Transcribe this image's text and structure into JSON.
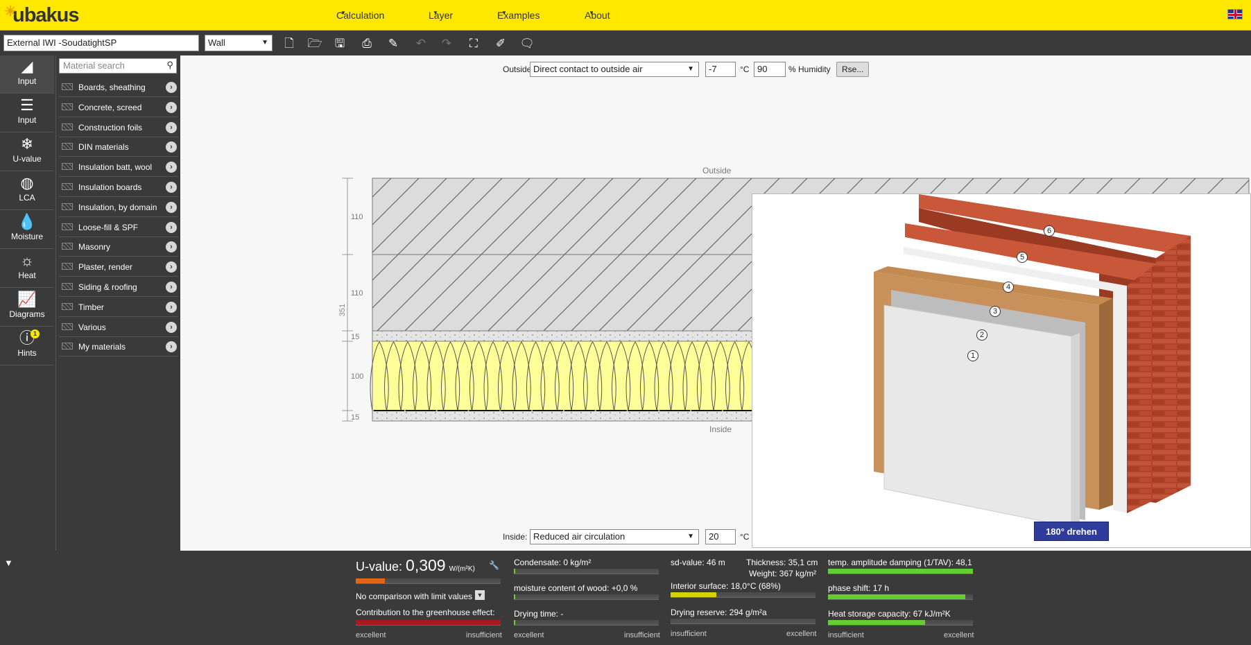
{
  "header": {
    "logo": "ubakus",
    "nav": [
      {
        "label": "Calculation"
      },
      {
        "label": "Layer"
      },
      {
        "label": "Examples"
      },
      {
        "label": "About"
      }
    ],
    "language_flag": "uk-flag-icon"
  },
  "toolbar": {
    "project_name": "External IWI -SoudatightSP",
    "construction_type": "Wall",
    "icons": [
      "new-file-icon",
      "open-folder-icon",
      "save-icon",
      "pdf-icon",
      "edit-icon",
      "undo-icon",
      "redo-icon",
      "fit-screen-icon",
      "brush-icon",
      "comment-icon"
    ]
  },
  "sidebar": {
    "items": [
      {
        "label": "Input",
        "icon": "slope-icon"
      },
      {
        "label": "Input",
        "icon": "layers-icon"
      },
      {
        "label": "U-value",
        "icon": "thermometer-icon"
      },
      {
        "label": "LCA",
        "icon": "globe-icon"
      },
      {
        "label": "Moisture",
        "icon": "drop-icon"
      },
      {
        "label": "Heat",
        "icon": "sun-icon"
      },
      {
        "label": "Diagrams",
        "icon": "chart-icon"
      },
      {
        "label": "Hints",
        "icon": "warning-icon",
        "badge": "1"
      }
    ]
  },
  "materials": {
    "search_placeholder": "Material search",
    "items": [
      {
        "label": "Boards, sheathing"
      },
      {
        "label": "Concrete, screed"
      },
      {
        "label": "Construction foils"
      },
      {
        "label": "DIN materials"
      },
      {
        "label": "Insulation batt, wool"
      },
      {
        "label": "Insulation boards"
      },
      {
        "label": "Insulation, by domain"
      },
      {
        "label": "Loose-fill & SPF"
      },
      {
        "label": "Masonry"
      },
      {
        "label": "Plaster, render"
      },
      {
        "label": "Siding & roofing"
      },
      {
        "label": "Timber"
      },
      {
        "label": "Various"
      },
      {
        "label": "My materials"
      }
    ]
  },
  "outside": {
    "label": "Outside",
    "condition": "Direct contact to outside air",
    "temperature": "-7",
    "temp_unit": "°C",
    "humidity": "90",
    "humidity_label": "% Humidity",
    "rse_button": "Rse..."
  },
  "inside": {
    "label": "Inside:",
    "condition": "Reduced air circulation",
    "temperature": "20",
    "temp_unit": "°C"
  },
  "section": {
    "top_label": "Outside",
    "bottom_label": "Inside",
    "total_thickness": "351",
    "layers": [
      {
        "thickness": "110"
      },
      {
        "thickness": "110"
      },
      {
        "thickness": "15"
      },
      {
        "thickness": "100"
      },
      {
        "thickness": "15"
      }
    ]
  },
  "model3d": {
    "layer_numbers": [
      "1",
      "2",
      "3",
      "4",
      "5",
      "6"
    ],
    "rotate_button": "180° drehen"
  },
  "results": {
    "uvalue_label": "U-value:",
    "uvalue": "0,309",
    "uvalue_unit": "W/(m²K)",
    "uvalue_fill": 0.2,
    "comparison": "No comparison with limit values",
    "greenhouse": "Contribution to the greenhouse effect:",
    "condensate": "Condensate: 0 kg/m²",
    "wood_moisture": "moisture content of wood: +0,0 %",
    "drying_time": "Drying time: -",
    "sd_value": "sd-value: 46 m",
    "thickness": "Thickness: 35,1 cm",
    "weight": "Weight: 367 kg/m²",
    "interior_surface": "Interior surface: 18,0°C (68%)",
    "drying_reserve": "Drying reserve: 294 g/m²a",
    "temp_amplitude": "temp. amplitude damping (1/TAV): 48,1",
    "phase_shift": "phase shift: 17 h",
    "heat_storage": "Heat storage capacity: 67 kJ/m²K",
    "scale_excellent": "excellent",
    "scale_insufficient": "insufficient"
  }
}
